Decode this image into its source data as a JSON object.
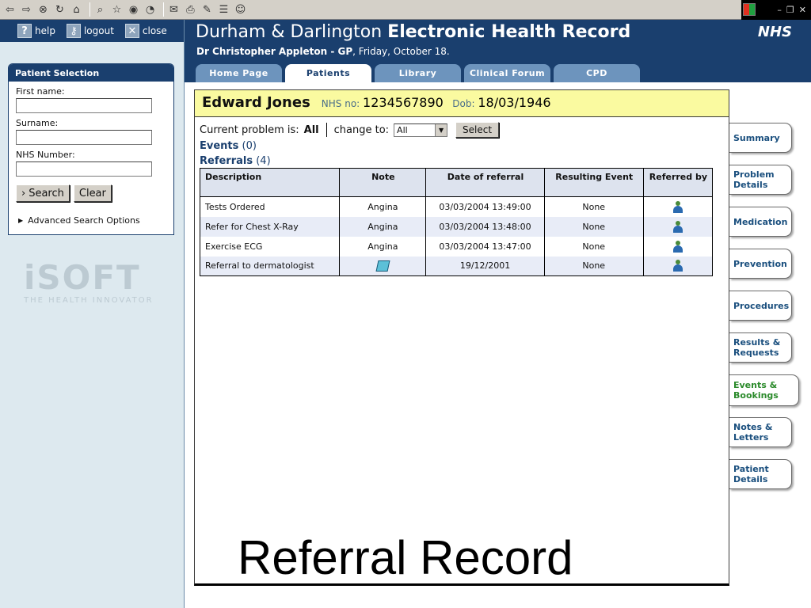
{
  "left_top": {
    "help": "help",
    "logout": "logout",
    "close": "close"
  },
  "patient_selection": {
    "title": "Patient Selection",
    "first_name_label": "First name:",
    "surname_label": "Surname:",
    "nhs_number_label": "NHS Number:",
    "first_name_value": "",
    "surname_value": "",
    "nhs_number_value": "",
    "search_button": "Search",
    "clear_button": "Clear",
    "advanced_search": "Advanced Search Options"
  },
  "isoft": {
    "logo_text": "iSOFT",
    "tagline": "THE HEALTH INNOVATOR"
  },
  "header": {
    "title_plain": "Durham & Darlington ",
    "title_bold": "Electronic Health Record",
    "nhs_logo": "NHS",
    "doctor_name": "Dr Christopher Appleton - GP",
    "date": ", Friday, October 18."
  },
  "nav_tabs": [
    {
      "label": "Home Page"
    },
    {
      "label": "Patients"
    },
    {
      "label": "Library"
    },
    {
      "label": "Clinical Forum"
    },
    {
      "label": "CPD"
    }
  ],
  "patient": {
    "name": "Edward Jones",
    "nhs_label": "NHS no:",
    "nhs_value": "1234567890",
    "dob_label": "Dob:",
    "dob_value": "18/03/1946"
  },
  "problem": {
    "label": "Current problem is:",
    "value": "All",
    "change_label": "change to:",
    "select_value": "All",
    "select_button": "Select"
  },
  "events": {
    "label": "Events",
    "count": "(0)"
  },
  "referrals": {
    "label": "Referrals",
    "count": "(4)"
  },
  "table": {
    "headers": [
      "Description",
      "Note",
      "Date of referral",
      "Resulting Event",
      "Referred by"
    ],
    "rows": [
      {
        "description": "Tests Ordered",
        "note": "Angina",
        "date": "03/03/2004 13:49:00",
        "result": "None"
      },
      {
        "description": "Refer for Chest X-Ray",
        "note": "Angina",
        "date": "03/03/2004 13:48:00",
        "result": "None"
      },
      {
        "description": "Exercise ECG",
        "note": "Angina",
        "date": "03/03/2004 13:47:00",
        "result": "None"
      },
      {
        "description": "Referral to dermatologist",
        "note": "",
        "date": "19/12/2001",
        "result": "None"
      }
    ]
  },
  "caption": "Referral Record",
  "side_tabs": [
    {
      "line1": "Summary",
      "line2": ""
    },
    {
      "line1": "Problem",
      "line2": "Details"
    },
    {
      "line1": "Medication",
      "line2": ""
    },
    {
      "line1": "Prevention",
      "line2": ""
    },
    {
      "line1": "Procedures",
      "line2": ""
    },
    {
      "line1": "Results &",
      "line2": "Requests"
    },
    {
      "line1": "Events &",
      "line2": "Bookings"
    },
    {
      "line1": "Notes &",
      "line2": "Letters"
    },
    {
      "line1": "Patient",
      "line2": "Details"
    }
  ],
  "colors": {
    "header_blue": "#1a3f6e",
    "tab_blue": "#6d94bd",
    "banner_yellow": "#fafaa0",
    "left_panel": "#dde9ef",
    "active_side_tab": "#2a8a2a"
  }
}
